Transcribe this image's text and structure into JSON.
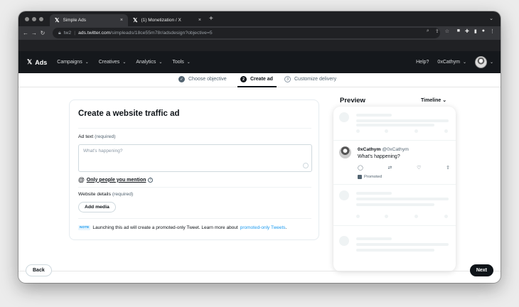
{
  "browser": {
    "tabs": [
      {
        "title": "Simple Ads",
        "close": "×"
      },
      {
        "title": "(1) Monetization / X",
        "close": "×"
      }
    ],
    "new_tab": "+",
    "url_prefix": "tw2",
    "url_host": "ads.twitter.com",
    "url_path": "/simpleads/18ce55m78r/adsdesign?objective=5"
  },
  "ads_nav": {
    "brand": "Ads",
    "items": [
      {
        "label": "Campaigns"
      },
      {
        "label": "Creatives"
      },
      {
        "label": "Analytics"
      },
      {
        "label": "Tools"
      }
    ],
    "help": "Help?",
    "account": "0xCathym"
  },
  "steps": [
    {
      "num": "✓",
      "label": "Choose objective",
      "state": "done"
    },
    {
      "num": "2",
      "label": "Create ad",
      "state": "current"
    },
    {
      "num": "3",
      "label": "Customize delivery",
      "state": "todo"
    }
  ],
  "form": {
    "title": "Create a website traffic ad",
    "ad_text_label": "Ad text",
    "ad_text_required": "(required)",
    "ad_text_placeholder": "What's happening?",
    "mention_prefix": "@",
    "mention_label": "Only people you mention",
    "website_label": "Website details",
    "website_required": "(required)",
    "add_media": "Add media",
    "note_tag": "NOTE",
    "note_text": "Launching this ad will create a promoted-only Tweet. Learn more about",
    "note_link": "promoted-only Tweets",
    "note_end": "."
  },
  "preview": {
    "title": "Preview",
    "mode": "Timeline",
    "tweet": {
      "name": "0xCathym",
      "handle": "@0xCathym",
      "text": "What's happening?",
      "promoted": "Promoted"
    }
  },
  "footer": {
    "back": "Back",
    "next": "Next"
  }
}
